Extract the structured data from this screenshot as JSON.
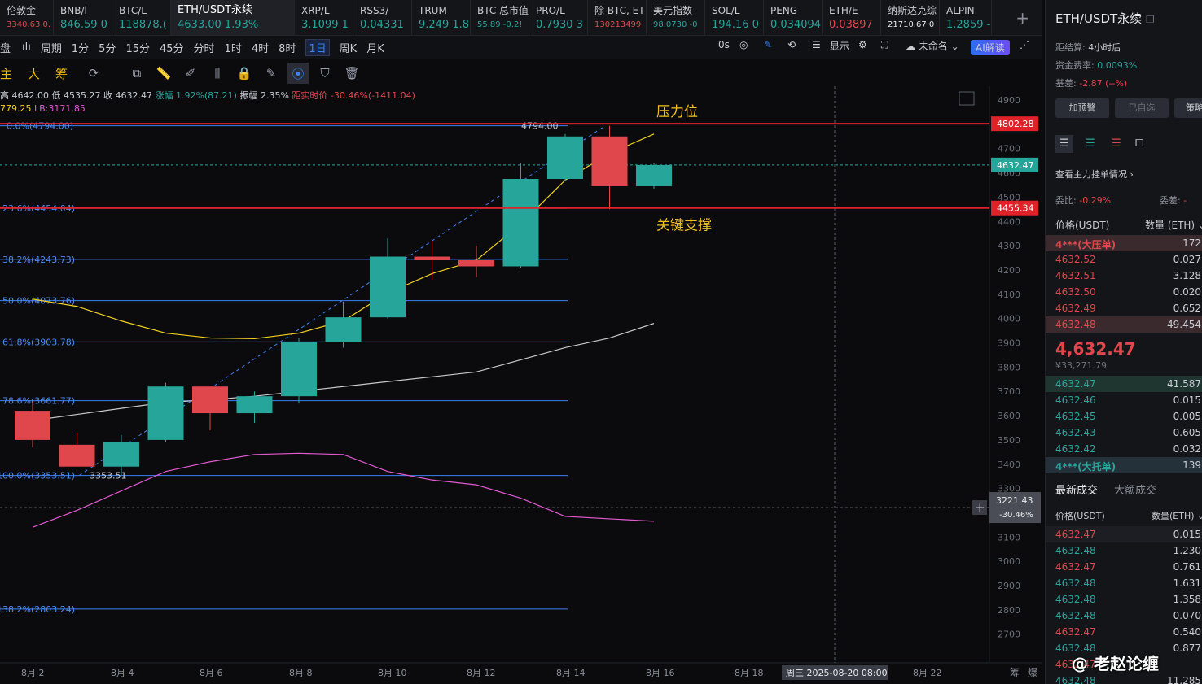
{
  "tickers": [
    {
      "name": "伦敦金",
      "price": "3340.63 0.",
      "color": "red",
      "w": 66,
      "small": true,
      "dot": false
    },
    {
      "name": "BNB/l",
      "price": "846.59 0",
      "color": "green",
      "w": 72,
      "dot": true
    },
    {
      "name": "BTC/L",
      "price": "118878.(",
      "color": "green",
      "w": 72,
      "dot": true
    },
    {
      "name": "ETH/USDT永续",
      "price": "4633.00 1.93%",
      "color": "green",
      "w": 152,
      "dot": true,
      "active": true
    },
    {
      "name": "XRP/L",
      "price": "3.1099 1",
      "color": "green",
      "w": 72,
      "dot": true
    },
    {
      "name": "RSS3/",
      "price": "0.04331",
      "color": "green",
      "w": 72,
      "dot": false
    },
    {
      "name": "TRUM",
      "price": "9.249 1.8",
      "color": "green",
      "w": 72,
      "dot": true
    },
    {
      "name": "BTC 总市值",
      "price": "55.89 -0.2!",
      "color": "green",
      "w": 72,
      "small": true,
      "dot": false
    },
    {
      "name": "PRO/L",
      "price": "0.7930 3",
      "color": "green",
      "w": 72,
      "dot": true
    },
    {
      "name": "除 BTC, ET",
      "price": "130213499",
      "color": "red",
      "w": 72,
      "small": true,
      "dot": false
    },
    {
      "name": "美元指数",
      "price": "98.0730 -0",
      "color": "green",
      "w": 72,
      "small": true,
      "dot": false
    },
    {
      "name": "SOL/L",
      "price": "194.16 0",
      "color": "green",
      "w": 72,
      "dot": true
    },
    {
      "name": "PENG",
      "price": "0.034094",
      "color": "green",
      "w": 72,
      "dot": true
    },
    {
      "name": "ETH/E",
      "price": "0.03897",
      "color": "red",
      "w": 72,
      "dot": true
    },
    {
      "name": "纳斯达克综",
      "price": "21710.67 0",
      "color": "white",
      "w": 72,
      "small": true,
      "dot": false
    },
    {
      "name": "ALPIN",
      "price": "1.2859 -",
      "color": "green",
      "w": 64,
      "dot": true
    }
  ],
  "toolbar": {
    "items": [
      "盘",
      "ılı",
      "周期",
      "1分",
      "5分",
      "15分",
      "45分",
      "分时",
      "1时",
      "4时",
      "8时",
      "1日",
      "周K",
      "月K"
    ],
    "active": "1日",
    "right": {
      "countdown": "0s",
      "display": "显示",
      "unnamed": "未命名",
      "ai": "AI解读"
    }
  },
  "drawbar": {
    "labels": [
      "主",
      "大",
      "筹"
    ]
  },
  "info": {
    "high": "高 4642.00",
    "low": "低 4535.27",
    "close": "收 4632.47",
    "change": "涨幅 1.92%(87.21)",
    "amplitude": "振幅 2.35%",
    "dist": "距实时价 -30.46%(-1411.04)",
    "ma": "779.25",
    "lb": "LB:3171.85"
  },
  "chart_data": {
    "type": "candlestick",
    "symbol": "ETH/USDT永续",
    "interval": "1日",
    "ylim": [
      2620,
      4960
    ],
    "yticks": [
      4900,
      4800,
      4700,
      4600,
      4500,
      4400,
      4300,
      4200,
      4100,
      4000,
      3900,
      3800,
      3700,
      3600,
      3500,
      3400,
      3300,
      3200,
      3100,
      3000,
      2900,
      2800,
      2700
    ],
    "xlabels": [
      "8月 2",
      "8月 4",
      "8月 6",
      "8月 8",
      "8月 10",
      "8月 12",
      "8月 14",
      "8月 16",
      "8月 18",
      "8月 22"
    ],
    "crosshair_date": "周三 2025-08-20 08:00",
    "candles": [
      {
        "i": 0,
        "o": 3620,
        "h": 3660,
        "l": 3470,
        "c": 3500
      },
      {
        "i": 1,
        "o": 3480,
        "h": 3530,
        "l": 3400,
        "c": 3390
      },
      {
        "i": 2,
        "o": 3390,
        "h": 3520,
        "l": 3355,
        "c": 3490
      },
      {
        "i": 3,
        "o": 3500,
        "h": 3735,
        "l": 3490,
        "c": 3720
      },
      {
        "i": 4,
        "o": 3720,
        "h": 3720,
        "l": 3540,
        "c": 3610
      },
      {
        "i": 5,
        "o": 3610,
        "h": 3700,
        "l": 3570,
        "c": 3680
      },
      {
        "i": 6,
        "o": 3680,
        "h": 3920,
        "l": 3650,
        "c": 3905
      },
      {
        "i": 7,
        "o": 3905,
        "h": 4070,
        "l": 3880,
        "c": 4005
      },
      {
        "i": 8,
        "o": 4005,
        "h": 4330,
        "l": 4000,
        "c": 4255
      },
      {
        "i": 9,
        "o": 4255,
        "h": 4320,
        "l": 4160,
        "c": 4240
      },
      {
        "i": 10,
        "o": 4240,
        "h": 4300,
        "l": 4170,
        "c": 4215
      },
      {
        "i": 11,
        "o": 4215,
        "h": 4640,
        "l": 4210,
        "c": 4575
      },
      {
        "i": 12,
        "o": 4575,
        "h": 4760,
        "l": 4565,
        "c": 4750
      },
      {
        "i": 13,
        "o": 4750,
        "h": 4794,
        "l": 4450,
        "c": 4545
      },
      {
        "i": 14,
        "o": 4545,
        "h": 4642,
        "l": 4535,
        "c": 4632
      }
    ],
    "ma_yellow": [
      [
        0,
        4080
      ],
      [
        1,
        4050
      ],
      [
        2,
        3990
      ],
      [
        3,
        3940
      ],
      [
        4,
        3920
      ],
      [
        5,
        3917
      ],
      [
        6,
        3940
      ],
      [
        7,
        3990
      ],
      [
        8,
        4105
      ],
      [
        9,
        4185
      ],
      [
        10,
        4240
      ],
      [
        11,
        4390
      ],
      [
        12,
        4570
      ],
      [
        13,
        4680
      ],
      [
        14,
        4760
      ]
    ],
    "ma_white": [
      [
        0,
        3580
      ],
      [
        1,
        3605
      ],
      [
        2,
        3630
      ],
      [
        3,
        3655
      ],
      [
        4,
        3665
      ],
      [
        5,
        3680
      ],
      [
        6,
        3700
      ],
      [
        7,
        3720
      ],
      [
        8,
        3740
      ],
      [
        9,
        3760
      ],
      [
        10,
        3780
      ],
      [
        11,
        3830
      ],
      [
        12,
        3880
      ],
      [
        13,
        3920
      ],
      [
        14,
        3980
      ]
    ],
    "ma_pink": [
      [
        0,
        3140
      ],
      [
        1,
        3210
      ],
      [
        2,
        3290
      ],
      [
        3,
        3370
      ],
      [
        4,
        3410
      ],
      [
        5,
        3440
      ],
      [
        6,
        3445
      ],
      [
        7,
        3440
      ],
      [
        8,
        3370
      ],
      [
        9,
        3335
      ],
      [
        10,
        3315
      ],
      [
        11,
        3260
      ],
      [
        12,
        3185
      ],
      [
        13,
        3175
      ],
      [
        14,
        3165
      ]
    ],
    "fib_levels": [
      {
        "label": "0.0%(4794.00)",
        "value": 4794.0
      },
      {
        "label": "23.6%(4454.04)",
        "value": 4454.04
      },
      {
        "label": "38.2%(4243.73)",
        "value": 4243.73
      },
      {
        "label": "50.0%(4073.76)",
        "value": 4073.76
      },
      {
        "label": "61.8%(3903.78)",
        "value": 3903.78
      },
      {
        "label": "78.6%(3661.77)",
        "value": 3661.77
      },
      {
        "label": "100.0%(3353.51)",
        "value": 3353.51
      },
      {
        "label": "138.2%(2803.24)",
        "value": 2803.24
      }
    ],
    "hlines": [
      {
        "label": "4802.28",
        "value": 4802.28,
        "color": "#e0232b",
        "annotation": "压力位"
      },
      {
        "label": "4455.34",
        "value": 4455.34,
        "color": "#e0232b",
        "annotation": "关键支撑"
      }
    ],
    "current_price": {
      "label": "4632.47",
      "value": 4632.47
    },
    "crosshair": {
      "price": "3221.43",
      "pct": "-30.46%",
      "value": 3221.43
    },
    "peak_label": "4794.00",
    "trough_label": "3353.51"
  },
  "right_panel": {
    "title": "ETH/USDT永续",
    "settle_label": "距结算:",
    "settle_value": "4小时后",
    "funding_label": "资金费率:",
    "funding_value": "0.0093%",
    "basis_label": "基差:",
    "basis_value": "-2.87 (--%)",
    "buttons": [
      "加预警",
      "已自选",
      "策略"
    ],
    "depth_link": "查看主力挂单情况",
    "ratio_label": "委比:",
    "ratio_value": "-0.29%",
    "diff_label": "委差:",
    "diff_value": "-",
    "ob_price_head": "价格(USDT)",
    "ob_qty_head": "数量 (ETH)",
    "asks": [
      {
        "p": "4***(大压单)",
        "q": "172",
        "big": true
      },
      {
        "p": "4632.52",
        "q": "0.027"
      },
      {
        "p": "4632.51",
        "q": "3.128"
      },
      {
        "p": "4632.50",
        "q": "0.020"
      },
      {
        "p": "4632.49",
        "q": "0.652"
      },
      {
        "p": "4632.48",
        "q": "49.454",
        "hl": true
      }
    ],
    "last_price": "4,632.47",
    "last_cny": "¥33,271.79",
    "bids": [
      {
        "p": "4632.47",
        "q": "41.587",
        "hl": true
      },
      {
        "p": "4632.46",
        "q": "0.015"
      },
      {
        "p": "4632.45",
        "q": "0.005"
      },
      {
        "p": "4632.43",
        "q": "0.605"
      },
      {
        "p": "4632.42",
        "q": "0.032"
      },
      {
        "p": "4***(大托单)",
        "q": "139",
        "big": true
      }
    ],
    "trade_tabs": [
      "最新成交",
      "大额成交"
    ],
    "trade_price_head": "价格(USDT)",
    "trade_qty_head": "数量(ETH)",
    "trades": [
      {
        "p": "4632.47",
        "q": "0.015",
        "side": "sell"
      },
      {
        "p": "4632.48",
        "q": "1.230",
        "side": "buy"
      },
      {
        "p": "4632.47",
        "q": "0.761",
        "side": "sell"
      },
      {
        "p": "4632.48",
        "q": "1.631",
        "side": "buy"
      },
      {
        "p": "4632.48",
        "q": "1.358",
        "side": "buy"
      },
      {
        "p": "4632.48",
        "q": "0.070",
        "side": "buy"
      },
      {
        "p": "4632.47",
        "q": "0.540",
        "side": "sell"
      },
      {
        "p": "4632.48",
        "q": "0.877",
        "side": "buy"
      },
      {
        "p": "4632.47",
        "q": "",
        "side": "sell"
      },
      {
        "p": "4632.48",
        "q": "11.285",
        "side": "buy"
      }
    ]
  },
  "watermark": "@ 老赵论缠",
  "bottom_right_labels": [
    "筹",
    "爆"
  ]
}
